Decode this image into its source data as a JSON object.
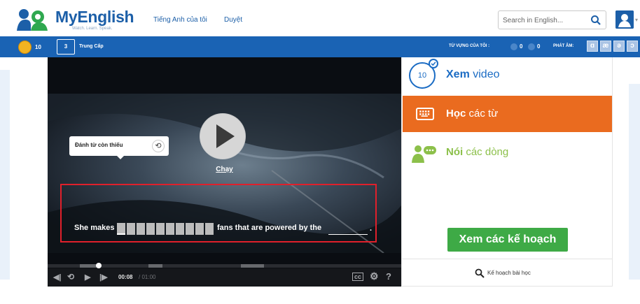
{
  "header": {
    "brand": "MyEnglish",
    "tagline": "Watch. Learn. Speak.",
    "nav": [
      "Tiếng Anh của tôi",
      "Duyệt"
    ],
    "search_placeholder": "Search in English..."
  },
  "status_bar": {
    "coins": "10",
    "level_number": "3",
    "level_name": "Trung Cấp",
    "vocab_label": "TỪ VỰNG CỦA TÔI :",
    "vocab_counts": [
      "0",
      "0"
    ],
    "phonetics_label": "PHÁT ÂM:",
    "phonetics": [
      "ɑ",
      "æ",
      "ə",
      "ɔ"
    ]
  },
  "video": {
    "play_label": "Chạy",
    "tooltip": "Đánh từ còn thiếu",
    "subtitle_before": "She makes",
    "subtitle_after": "fans that are powered by the",
    "subtitle_end": ".",
    "time_current": "00:08",
    "time_total": "/ 01:00"
  },
  "steps": {
    "watch_count": "10",
    "watch_bold": "Xem",
    "watch_rest": " video",
    "words_bold": "Học",
    "words_rest": " các từ",
    "speak_bold": "Nói",
    "speak_rest": " các dòng"
  },
  "plans_button": "Xem các kế hoạch",
  "lesson_plan": "Kế hoạch bài học",
  "colors": {
    "brand_blue": "#1a63b4",
    "active_orange": "#ea6b1f",
    "speak_green": "#8cc04a",
    "button_green": "#3eaa46"
  }
}
